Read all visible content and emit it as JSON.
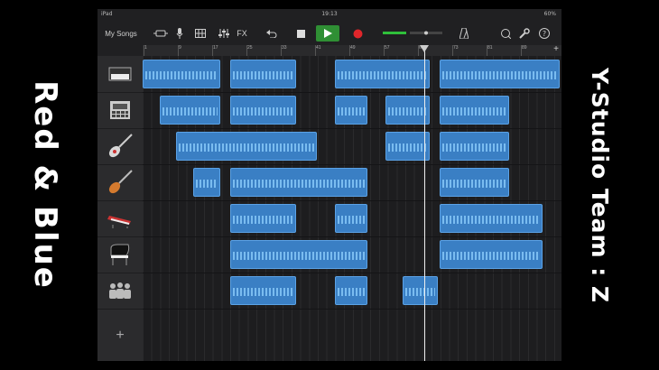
{
  "overlay": {
    "left_title": "Red & Blue",
    "right_title": "Y-Studio   Team : Z"
  },
  "status_bar": {
    "device": "iPad",
    "time": "19:13",
    "battery": "60%"
  },
  "toolbar": {
    "my_songs": "My Songs",
    "fx_label": "FX",
    "icons": [
      "view-toggle-icon",
      "microphone-icon",
      "grid-icon",
      "mixer-icon",
      "undo-icon",
      "stop-icon",
      "play-icon",
      "record-icon",
      "volume-meter-icon",
      "metronome-icon",
      "loop-icon",
      "settings-icon",
      "help-icon"
    ]
  },
  "ruler": {
    "marks": [
      "1",
      "9",
      "17",
      "25",
      "33",
      "41",
      "49",
      "57",
      "65",
      "73",
      "81",
      "89"
    ],
    "add_label": "+"
  },
  "tracks": [
    {
      "icon": "keyboard-icon",
      "selected": true,
      "regions": [
        [
          0,
          0.19
        ],
        [
          0.21,
          0.37
        ],
        [
          0.46,
          0.69
        ],
        [
          0.71,
          1.0
        ]
      ]
    },
    {
      "icon": "drum-machine-icon",
      "selected": false,
      "regions": [
        [
          0.04,
          0.19
        ],
        [
          0.21,
          0.37
        ],
        [
          0.46,
          0.54
        ],
        [
          0.58,
          0.69
        ],
        [
          0.71,
          0.88
        ]
      ]
    },
    {
      "icon": "electric-guitar-icon",
      "selected": false,
      "regions": [
        [
          0.08,
          0.42
        ],
        [
          0.58,
          0.69
        ],
        [
          0.71,
          0.88
        ]
      ]
    },
    {
      "icon": "bass-guitar-icon",
      "selected": false,
      "regions": [
        [
          0.12,
          0.19
        ],
        [
          0.21,
          0.54
        ],
        [
          0.71,
          0.88
        ]
      ]
    },
    {
      "icon": "synth-keyboard-icon",
      "selected": false,
      "regions": [
        [
          0.21,
          0.37
        ],
        [
          0.46,
          0.54
        ],
        [
          0.71,
          0.96
        ]
      ]
    },
    {
      "icon": "grand-piano-icon",
      "selected": false,
      "regions": [
        [
          0.21,
          0.54
        ],
        [
          0.71,
          0.96
        ]
      ]
    },
    {
      "icon": "choir-icon",
      "selected": false,
      "regions": [
        [
          0.21,
          0.37
        ],
        [
          0.46,
          0.54
        ],
        [
          0.62,
          0.71
        ]
      ]
    }
  ],
  "add_track_label": "+"
}
